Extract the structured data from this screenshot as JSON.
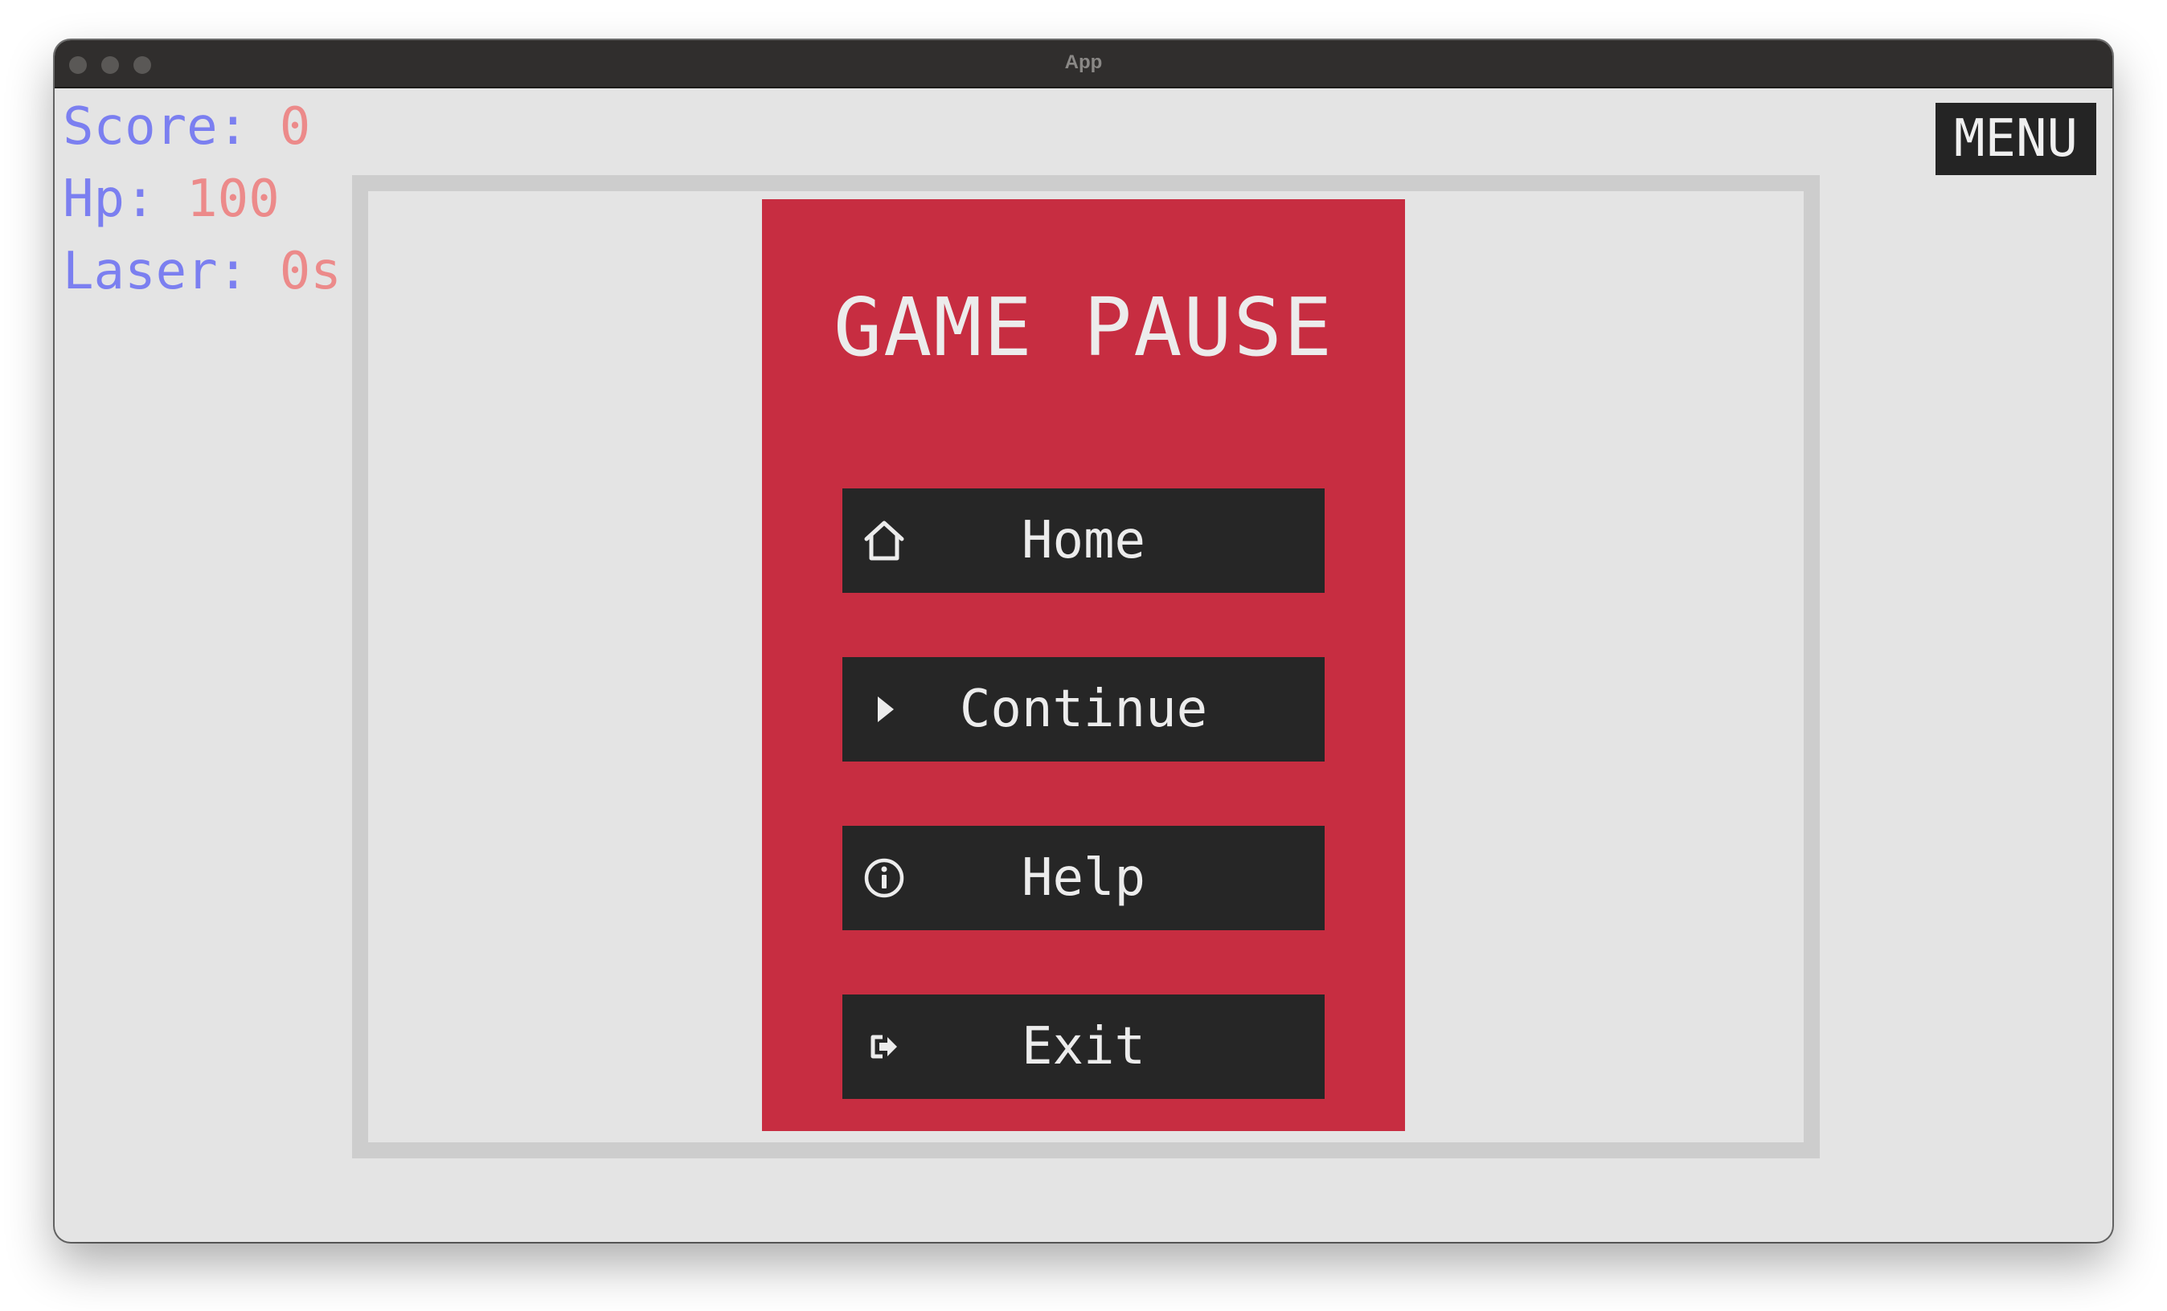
{
  "window": {
    "title": "App"
  },
  "hud": {
    "score_label": "Score:",
    "score_value": "0",
    "hp_label": "Hp:",
    "hp_value": "100",
    "laser_label": "Laser:",
    "laser_value": "0s"
  },
  "menu_button": {
    "label": "MENU"
  },
  "pause": {
    "title": "GAME PAUSE",
    "buttons": [
      {
        "label": "Home",
        "icon": "home-icon"
      },
      {
        "label": "Continue",
        "icon": "play-icon"
      },
      {
        "label": "Help",
        "icon": "info-icon"
      },
      {
        "label": "Exit",
        "icon": "exit-icon"
      }
    ]
  },
  "colors": {
    "panel": "#c72d41",
    "button_bg": "#262626",
    "hud_label": "#7b7ff0",
    "hud_value": "#ec8a8a",
    "background": "#e4e4e4",
    "arena_border": "#cdcdcd"
  }
}
